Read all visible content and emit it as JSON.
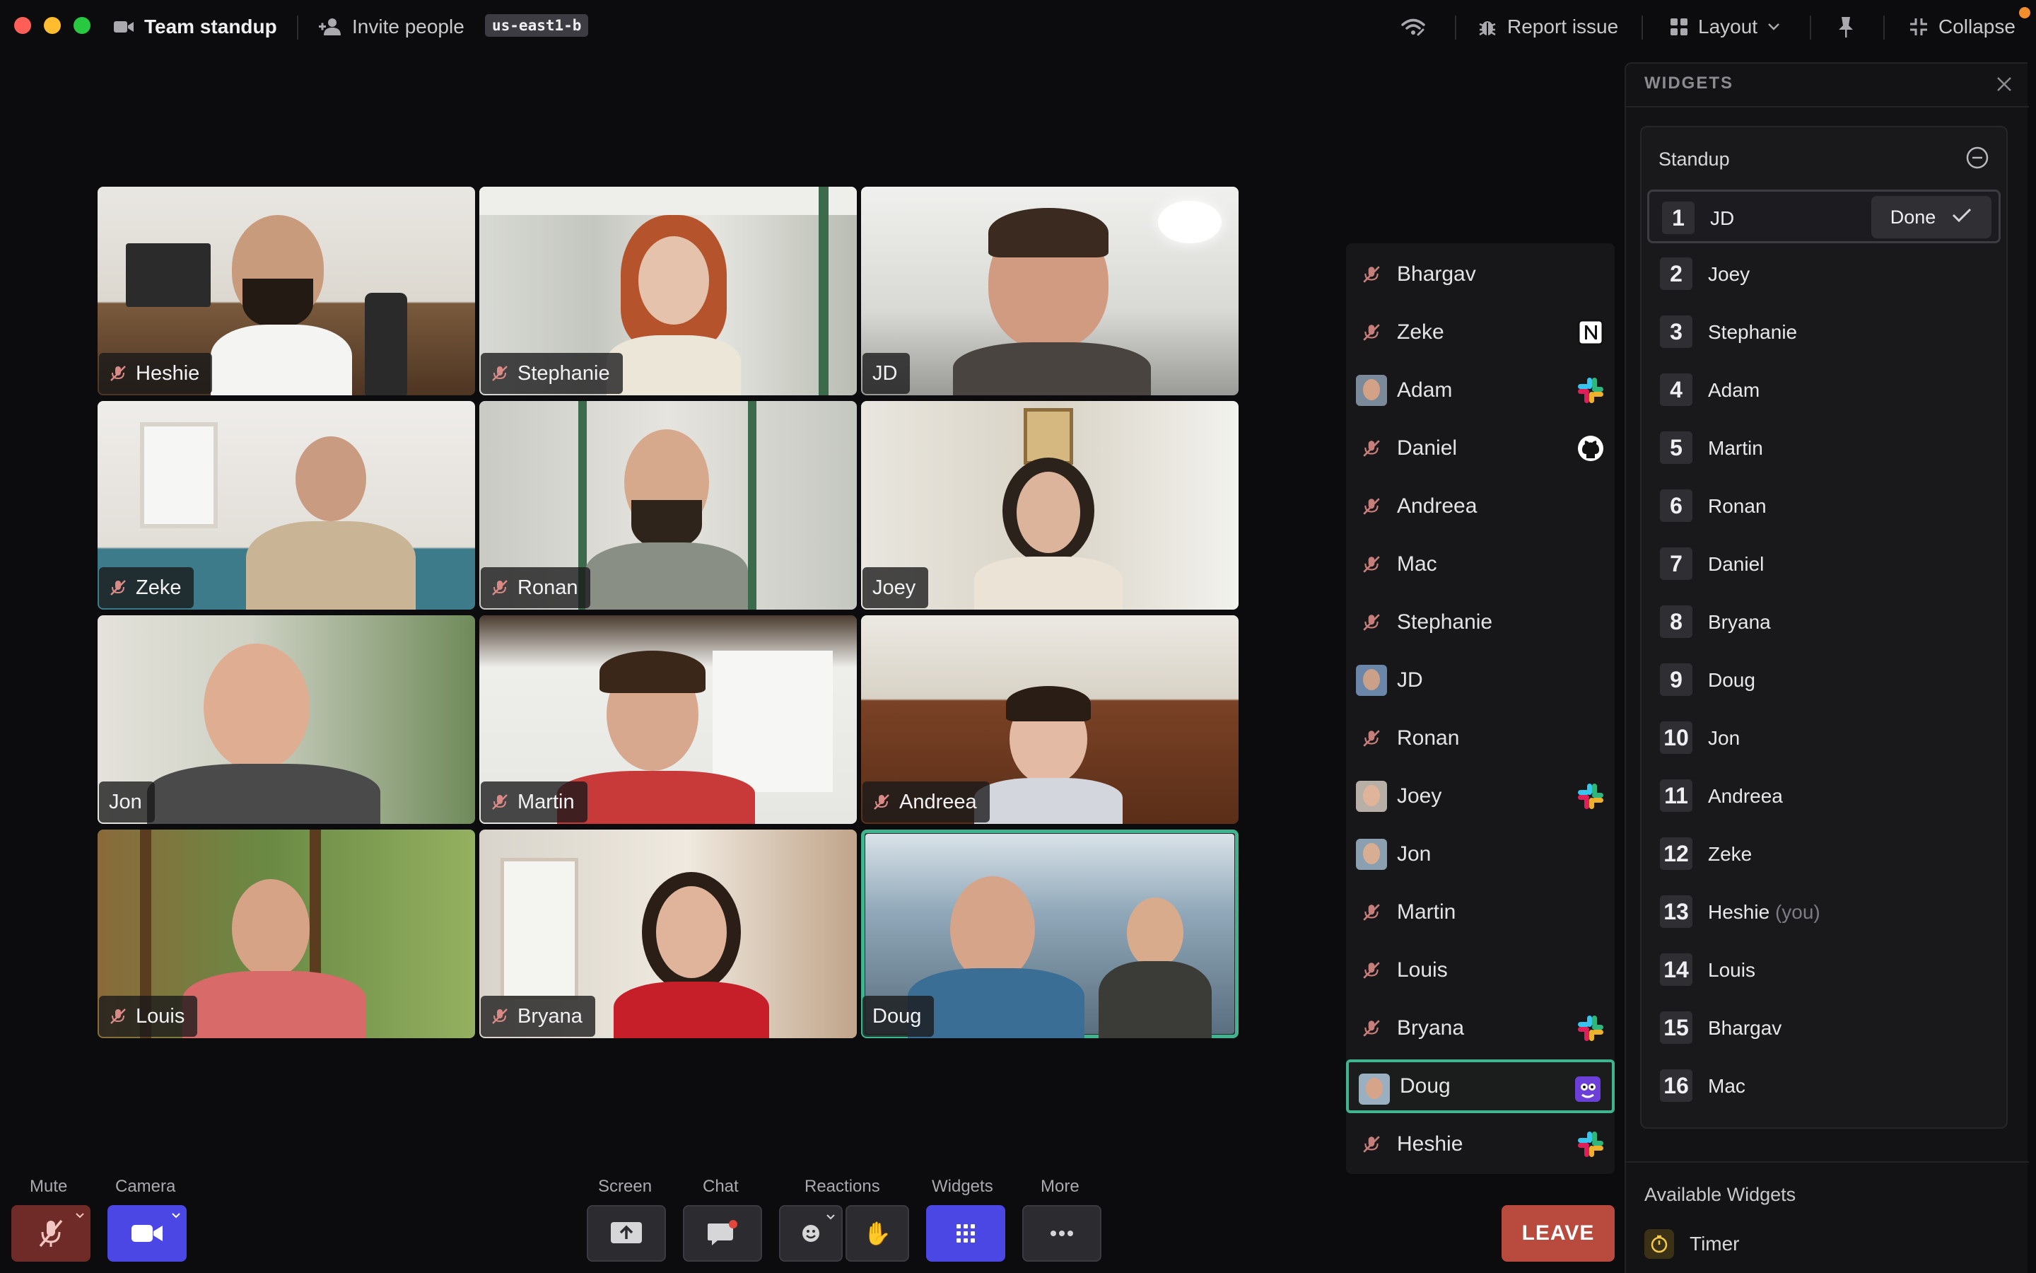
{
  "window": {
    "title": "Team standup",
    "invite_label": "Invite people",
    "region": "us-east1-b",
    "report_label": "Report issue",
    "layout_label": "Layout",
    "collapse_label": "Collapse"
  },
  "grid": [
    {
      "name": "Heshie",
      "muted": true,
      "active": false
    },
    {
      "name": "Stephanie",
      "muted": true,
      "active": false
    },
    {
      "name": "JD",
      "muted": false,
      "active": false
    },
    {
      "name": "Zeke",
      "muted": true,
      "active": false
    },
    {
      "name": "Ronan",
      "muted": true,
      "active": false
    },
    {
      "name": "Joey",
      "muted": false,
      "active": false
    },
    {
      "name": "Jon",
      "muted": false,
      "active": false
    },
    {
      "name": "Martin",
      "muted": true,
      "active": false
    },
    {
      "name": "Andreea",
      "muted": true,
      "active": false
    },
    {
      "name": "Louis",
      "muted": true,
      "active": false
    },
    {
      "name": "Bryana",
      "muted": true,
      "active": false
    },
    {
      "name": "Doug",
      "muted": false,
      "active": true
    }
  ],
  "participants": [
    {
      "name": "Bhargav",
      "lead": "mic-off",
      "app": ""
    },
    {
      "name": "Zeke",
      "lead": "mic-off",
      "app": "notion"
    },
    {
      "name": "Adam",
      "lead": "avatar",
      "app": "slack"
    },
    {
      "name": "Daniel",
      "lead": "mic-off",
      "app": "github"
    },
    {
      "name": "Andreea",
      "lead": "mic-off",
      "app": ""
    },
    {
      "name": "Mac",
      "lead": "mic-off",
      "app": ""
    },
    {
      "name": "Stephanie",
      "lead": "mic-off",
      "app": ""
    },
    {
      "name": "JD",
      "lead": "avatar",
      "app": ""
    },
    {
      "name": "Ronan",
      "lead": "mic-off",
      "app": ""
    },
    {
      "name": "Joey",
      "lead": "avatar",
      "app": "slack"
    },
    {
      "name": "Jon",
      "lead": "avatar",
      "app": ""
    },
    {
      "name": "Martin",
      "lead": "mic-off",
      "app": ""
    },
    {
      "name": "Louis",
      "lead": "mic-off",
      "app": ""
    },
    {
      "name": "Bryana",
      "lead": "mic-off",
      "app": "slack"
    },
    {
      "name": "Doug",
      "lead": "avatar",
      "app": "mascot",
      "highlight": true
    },
    {
      "name": "Heshie",
      "lead": "mic-off",
      "app": "slack"
    }
  ],
  "widgets": {
    "header": "WIDGETS",
    "standup_title": "Standup",
    "done_label": "Done",
    "you_suffix": "(you)",
    "order": [
      {
        "num": "1",
        "name": "JD",
        "current": true
      },
      {
        "num": "2",
        "name": "Joey"
      },
      {
        "num": "3",
        "name": "Stephanie"
      },
      {
        "num": "4",
        "name": "Adam"
      },
      {
        "num": "5",
        "name": "Martin"
      },
      {
        "num": "6",
        "name": "Ronan"
      },
      {
        "num": "7",
        "name": "Daniel"
      },
      {
        "num": "8",
        "name": "Bryana"
      },
      {
        "num": "9",
        "name": "Doug"
      },
      {
        "num": "10",
        "name": "Jon"
      },
      {
        "num": "11",
        "name": "Andreea"
      },
      {
        "num": "12",
        "name": "Zeke"
      },
      {
        "num": "13",
        "name": "Heshie",
        "you": true
      },
      {
        "num": "14",
        "name": "Louis"
      },
      {
        "num": "15",
        "name": "Bhargav"
      },
      {
        "num": "16",
        "name": "Mac"
      }
    ],
    "available_title": "Available Widgets",
    "available": [
      {
        "name": "Timer",
        "icon": "timer-icon"
      }
    ]
  },
  "controls": {
    "mute_label": "Mute",
    "camera_label": "Camera",
    "screen_label": "Screen",
    "chat_label": "Chat",
    "reactions_label": "Reactions",
    "widgets_label": "Widgets",
    "more_label": "More",
    "leave_label": "LEAVE"
  },
  "colors": {
    "accent_green": "#3fb48f",
    "accent_purple": "#4a47e4",
    "leave_red": "#b84a3e",
    "mute_red": "#6e2b27"
  }
}
